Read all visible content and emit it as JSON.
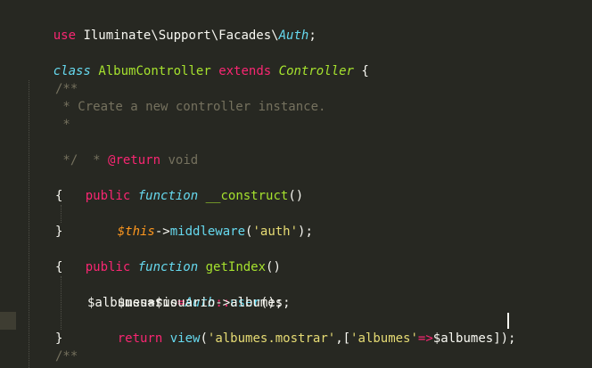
{
  "code": {
    "l1_kw": "use",
    "l1_ns": " Iluminate\\Support\\Facades\\",
    "l1_cls": "Auth",
    "l1_end": ";",
    "l2_kw": "class",
    "l2_name": "AlbumController",
    "l2_ext": "extends",
    "l2_parent": "Controller",
    "l2_brace": "{",
    "c1": "/**",
    "c2": " * Create a new controller instance.",
    "c3": " *",
    "c4a": " * ",
    "c4b": "@return",
    "c4c": " void",
    "c5": " */",
    "m1_vis": "public",
    "m1_fn": "function",
    "m1_name": "__construct",
    "m1_args": "()",
    "m1_open": "{",
    "m1_this": "$this",
    "m1_arrow": "->",
    "m1_call": "middleware",
    "m1_p1": "(",
    "m1_str": "'auth'",
    "m1_p2": ");",
    "m1_close": "}",
    "m2_vis": "public",
    "m2_fn": "function",
    "m2_name": "getIndex",
    "m2_args": "()",
    "m2_open": "{",
    "s1_var": "$usuario",
    "s1_eq": "=",
    "s1_cls": "Auth",
    "s1_op": "::",
    "s1_call": "user",
    "s1_end": "();",
    "s2": "$albumes=$usuario->albumes;",
    "s3_ret": "return",
    "s3_call": "view",
    "s3_p1": "(",
    "s3_str1": "'albumes.mostrar'",
    "s3_mid": ",[",
    "s3_str2": "'albumes'",
    "s3_arrow": "=>",
    "s3_var": "$albumes",
    "s3_end": "]);",
    "m2_close": "}",
    "c6": "/**"
  },
  "colors": {
    "background": "#272822",
    "keyword": "#f92672",
    "storage": "#66d9ef",
    "function_name": "#a6e22e",
    "string": "#e6db74",
    "comment": "#75715e",
    "this_var": "#fd971f"
  }
}
